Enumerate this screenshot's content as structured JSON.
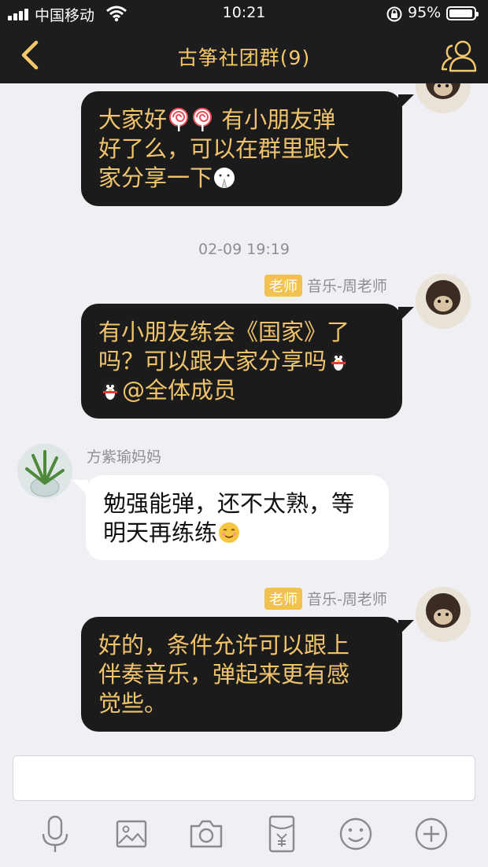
{
  "status_bar": {
    "carrier": "中国移动",
    "time": "10:21",
    "battery_percent_label": "95%",
    "battery_level": 0.95
  },
  "nav": {
    "title": "古筝社团群(9)",
    "back_icon": "chevron-left-icon",
    "member_icon": "group-members-icon"
  },
  "colors": {
    "nav_bg": "#1d1d1f",
    "accent": "#f5c86a",
    "chat_bg": "#efeff4",
    "dark_bubble": "#1b1b1b",
    "badge": "#f2c250"
  },
  "messages": [
    {
      "side": "right",
      "lines": [
        "大家好",
        "有小朋友弹",
        "好了么，可以在群里跟大",
        "家分享一下"
      ],
      "emojis": [
        "lollipop-emoji",
        "lollipop-emoji",
        "praying-emoji"
      ]
    },
    {
      "timestamp": "02-09 19:19"
    },
    {
      "side": "right",
      "badge": "老师",
      "sender": "音乐-周老师",
      "lines": [
        "有小朋友练会《国家》了",
        "吗？可以跟大家分享吗",
        "@全体成员"
      ],
      "emojis": [
        "qq-penguin-emoji",
        "qq-penguin-emoji"
      ]
    },
    {
      "side": "left",
      "sender": "方紫瑜妈妈",
      "lines": [
        "勉强能弹，还不太熟，等",
        "明天再练练"
      ],
      "emojis": [
        "smiling-face-emoji"
      ]
    },
    {
      "side": "right",
      "badge": "老师",
      "sender": "音乐-周老师",
      "lines": [
        "好的，条件允许可以跟上",
        "伴奏音乐，弹起来更有感",
        "觉些。"
      ]
    }
  ],
  "input": {
    "value": "",
    "placeholder": ""
  },
  "toolbar": {
    "icons": [
      "microphone-icon",
      "image-icon",
      "camera-icon",
      "red-packet-icon",
      "emoji-icon",
      "plus-icon"
    ]
  }
}
